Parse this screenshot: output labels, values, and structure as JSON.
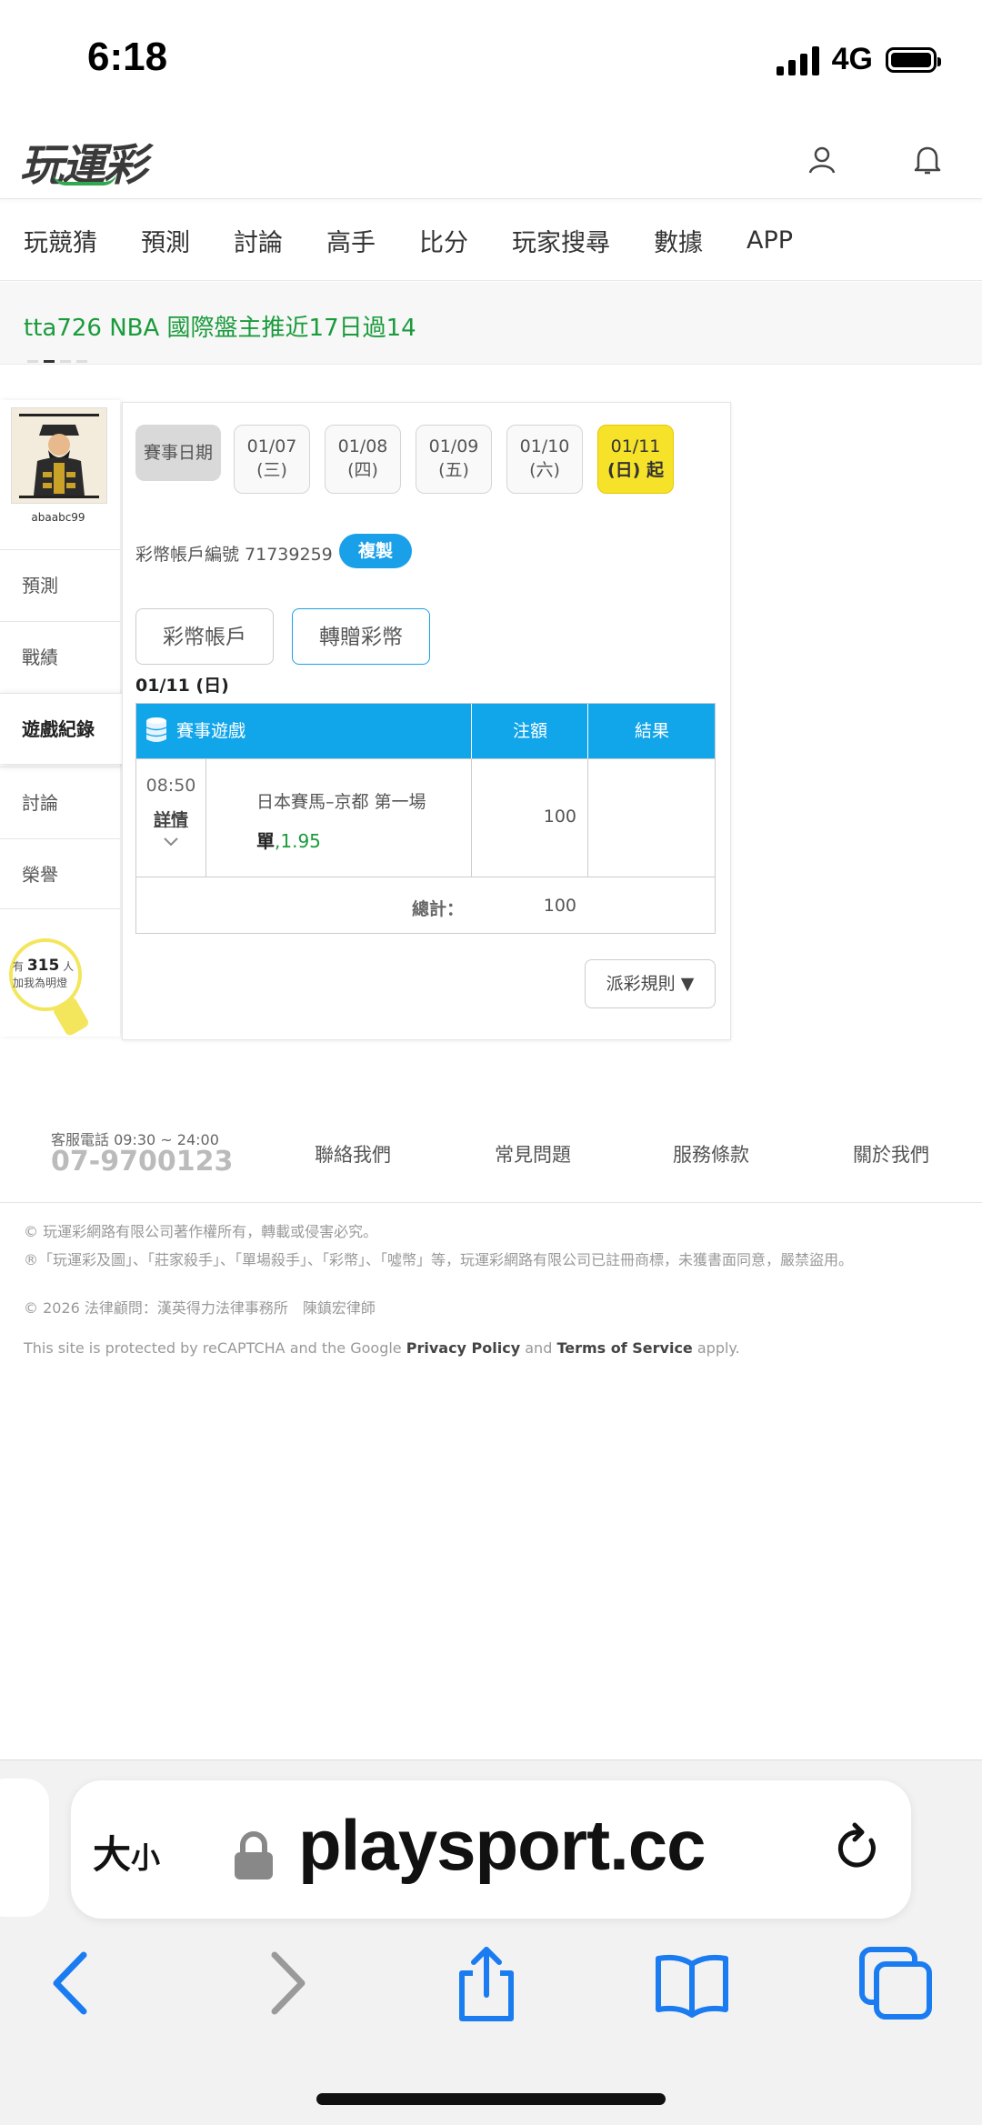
{
  "status": {
    "time": "6:18",
    "network": "4G"
  },
  "header": {
    "logo": "玩運彩"
  },
  "nav": [
    "玩競猜",
    "預測",
    "討論",
    "高手",
    "比分",
    "玩家搜尋",
    "數據",
    "APP"
  ],
  "banner": {
    "text": "tta726  NBA 國際盤主推近17日過14"
  },
  "sidebar": {
    "username": "abaabc99",
    "items": [
      "預測",
      "戰績",
      "遊戲紀錄",
      "討論",
      "榮譽"
    ],
    "active_index": 2,
    "bulb": {
      "prefix": "有",
      "count": "315",
      "suffix": "人",
      "line2": "加我為明燈"
    }
  },
  "panel": {
    "date_label": "賽事日期",
    "dates": [
      {
        "d": "01/07",
        "w": "(三)"
      },
      {
        "d": "01/08",
        "w": "(四)"
      },
      {
        "d": "01/09",
        "w": "(五)"
      },
      {
        "d": "01/10",
        "w": "(六)"
      },
      {
        "d": "01/11",
        "w": "(日) 起"
      }
    ],
    "account_label": "彩幣帳戶編號 71739259",
    "copy_label": "複製",
    "tabs": [
      "彩幣帳戶",
      "轉贈彩幣"
    ],
    "day_title": "01/11 (日)",
    "table": {
      "headers": [
        "賽事遊戲",
        "注額",
        "結果"
      ],
      "rows": [
        {
          "time": "08:50",
          "detail": "詳情",
          "event": "日本賽馬–京都 第一場",
          "pick": "單",
          "odds": ",1.95",
          "amount": "100",
          "result": ""
        }
      ],
      "total_label": "總計：",
      "total_value": "100"
    },
    "rules_label": "派彩規則 ▼"
  },
  "footer": {
    "service_hours": "客服電話 09:30 ~ 24:00",
    "phone": "07-9700123",
    "links": [
      "聯絡我們",
      "常見問題",
      "服務條款",
      "關於我們"
    ],
    "legal1": "© 玩運彩網路有限公司著作權所有，轉載或侵害必究。",
    "legal2": "®「玩運彩及圖」、「莊家殺手」、「單場殺手」、「彩幣」、「噓幣」等，玩運彩網路有限公司已註冊商標，未獲書面同意，嚴禁盜用。",
    "legal3": "© 2026 法律顧問：漢英得力法律事務所　陳鎮宏律師",
    "recaptcha_pre": "This site is protected by reCAPTCHA and the Google ",
    "privacy": "Privacy Policy",
    "and": " and ",
    "terms": "Terms of Service",
    "apply": " apply."
  },
  "browser": {
    "text_size_big": "大",
    "text_size_small": "小",
    "url": "playsport.cc"
  },
  "colors": {
    "accent_blue": "#11a5ea",
    "banner_green": "#1a9b3c",
    "active_date": "#f7e22a",
    "safari_blue": "#1a7cf0"
  }
}
